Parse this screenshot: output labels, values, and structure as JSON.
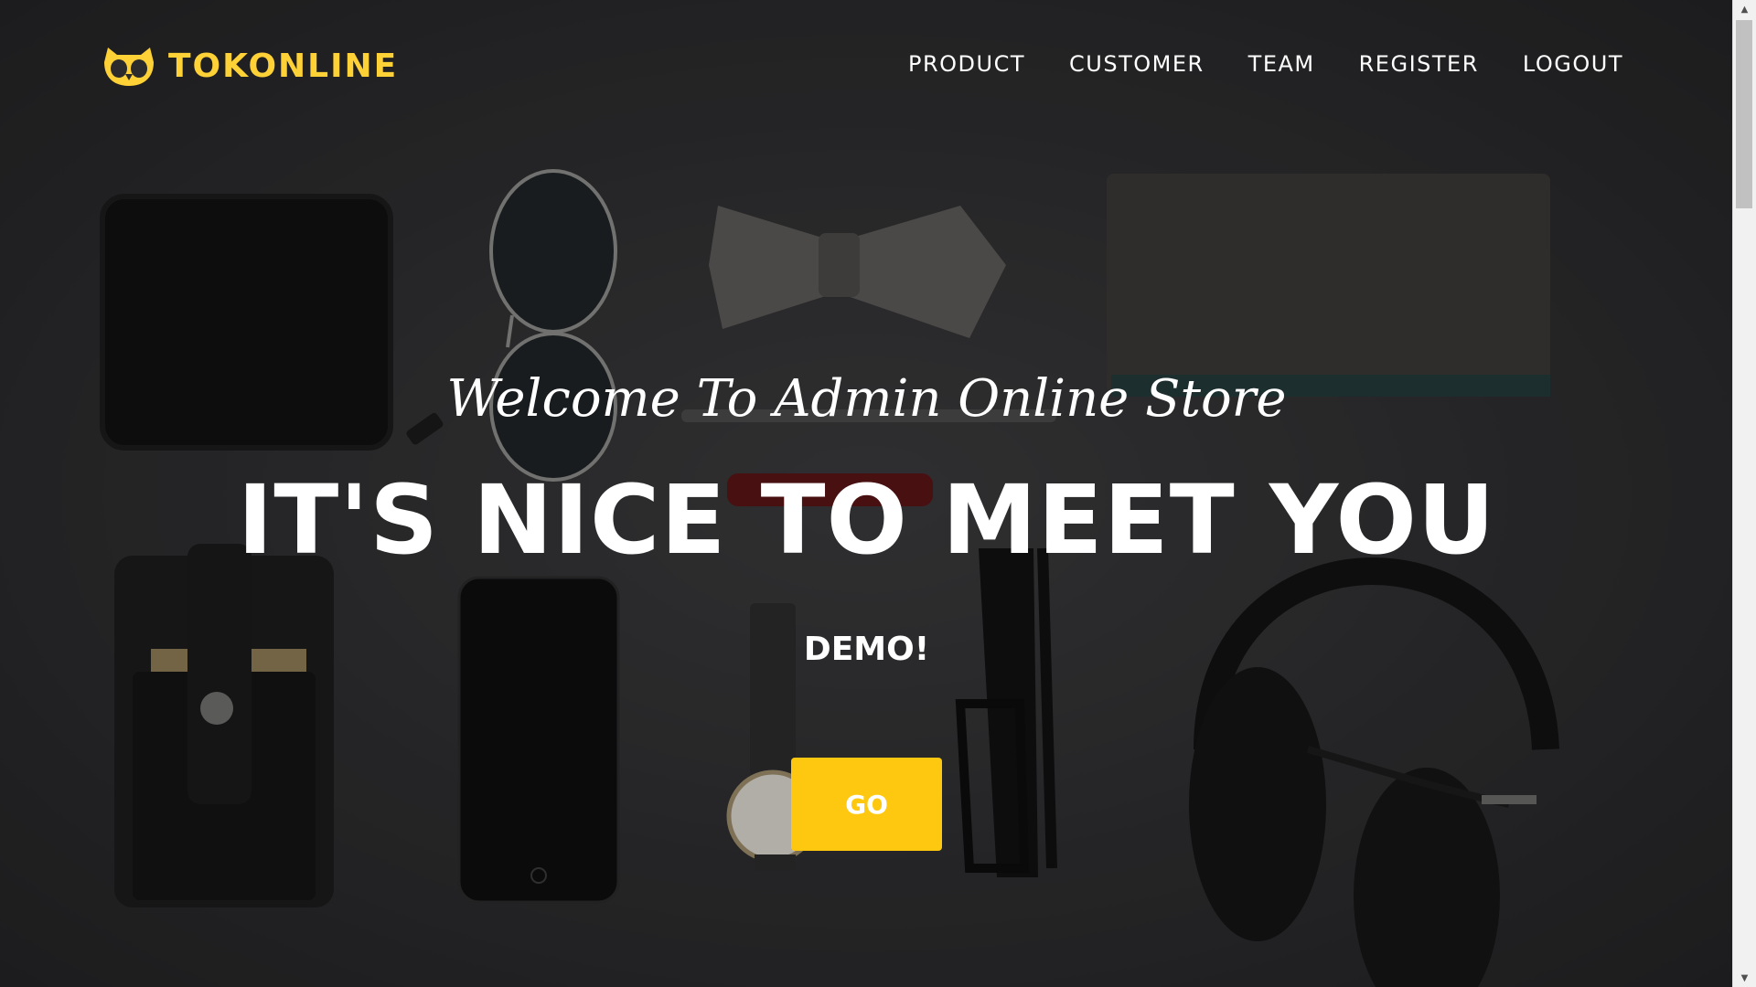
{
  "brand": {
    "name": "TOKONLINE",
    "accent_color": "#fed136",
    "logo_icon": "owl-icon"
  },
  "nav": {
    "items": [
      {
        "label": "PRODUCT"
      },
      {
        "label": "CUSTOMER"
      },
      {
        "label": "TEAM"
      },
      {
        "label": "REGISTER"
      },
      {
        "label": "LOGOUT"
      }
    ]
  },
  "hero": {
    "welcome": "Welcome To Admin Online Store",
    "headline": "IT'S NICE TO MEET YOU",
    "demo": "DEMO!",
    "button_label": "GO",
    "button_color": "#fec810",
    "background_image": "flat-lay of men's accessories on dark background"
  },
  "scrollbar": {
    "up_icon": "scroll-up-arrow-icon",
    "down_icon": "scroll-down-arrow-icon"
  }
}
